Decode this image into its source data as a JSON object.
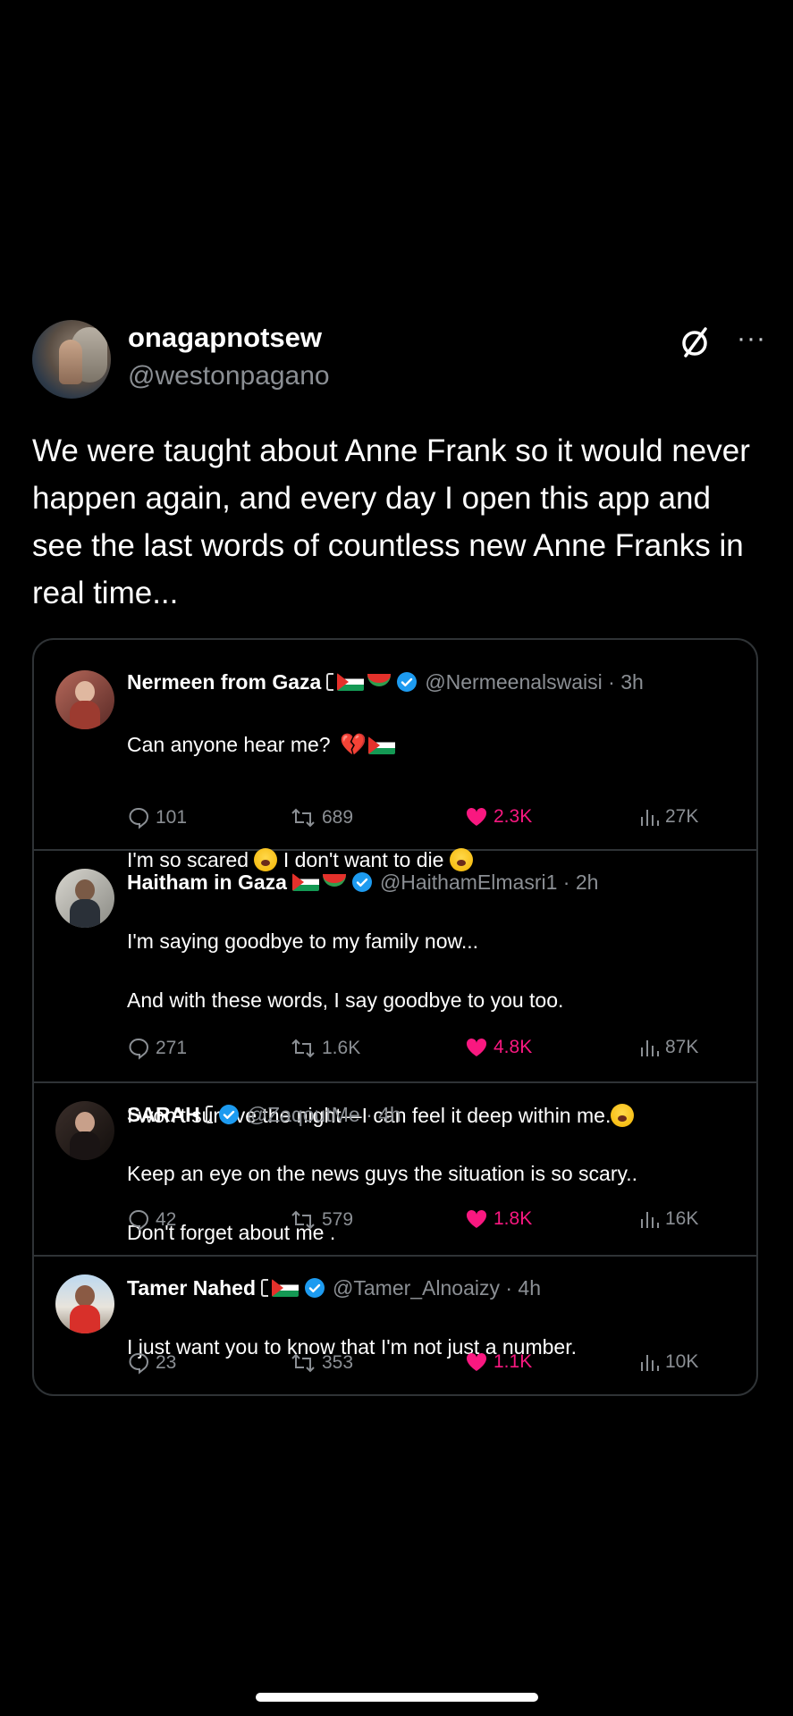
{
  "post": {
    "author_name": "onagapnotsew",
    "author_handle": "@westonpagano",
    "text": "We were taught about Anne Frank so it would never happen again, and every day I open this app and see the last words of countless new Anne Franks in real time...",
    "more_label": "···"
  },
  "tweets": [
    {
      "name": "Nermeen from Gaza",
      "handle_time": "@Nermeenalswaisi · 3h",
      "line1": "Can anyone hear me?",
      "line2a": "I'm so scared",
      "line2b": "I don't want to die",
      "replies": "101",
      "reposts": "689",
      "likes": "2.3K",
      "views": "27K"
    },
    {
      "name": "Haitham in Gaza",
      "handle_time": "@HaithamElmasri1 · 2h",
      "line1": "I'm saying goodbye to my family now...",
      "line2": "And with these words, I say goodbye to you too.",
      "line3": "I won't survive the night—I can feel it deep within me.",
      "replies": "271",
      "reposts": "1.6K",
      "likes": "4.8K",
      "views": "87K"
    },
    {
      "name": "SARAH",
      "handle_time": "@ZaqoutMe · 4h",
      "line1": "Keep an eye on the news guys the situation is so scary..",
      "line2": "Don't forget about me .",
      "replies": "42",
      "reposts": "579",
      "likes": "1.8K",
      "views": "16K"
    },
    {
      "name": "Tamer Nahed",
      "handle_time": "@Tamer_Alnoaizy · 4h",
      "line1": "I just want you to know that I'm not just a number.",
      "replies": "23",
      "reposts": "353",
      "likes": "1.1K",
      "views": "10K"
    }
  ],
  "colors": {
    "background": "#000000",
    "text": "#ffffff",
    "muted": "#8b8f94",
    "like": "#f91880",
    "verified": "#1d9bf0",
    "border": "#2f3336"
  }
}
